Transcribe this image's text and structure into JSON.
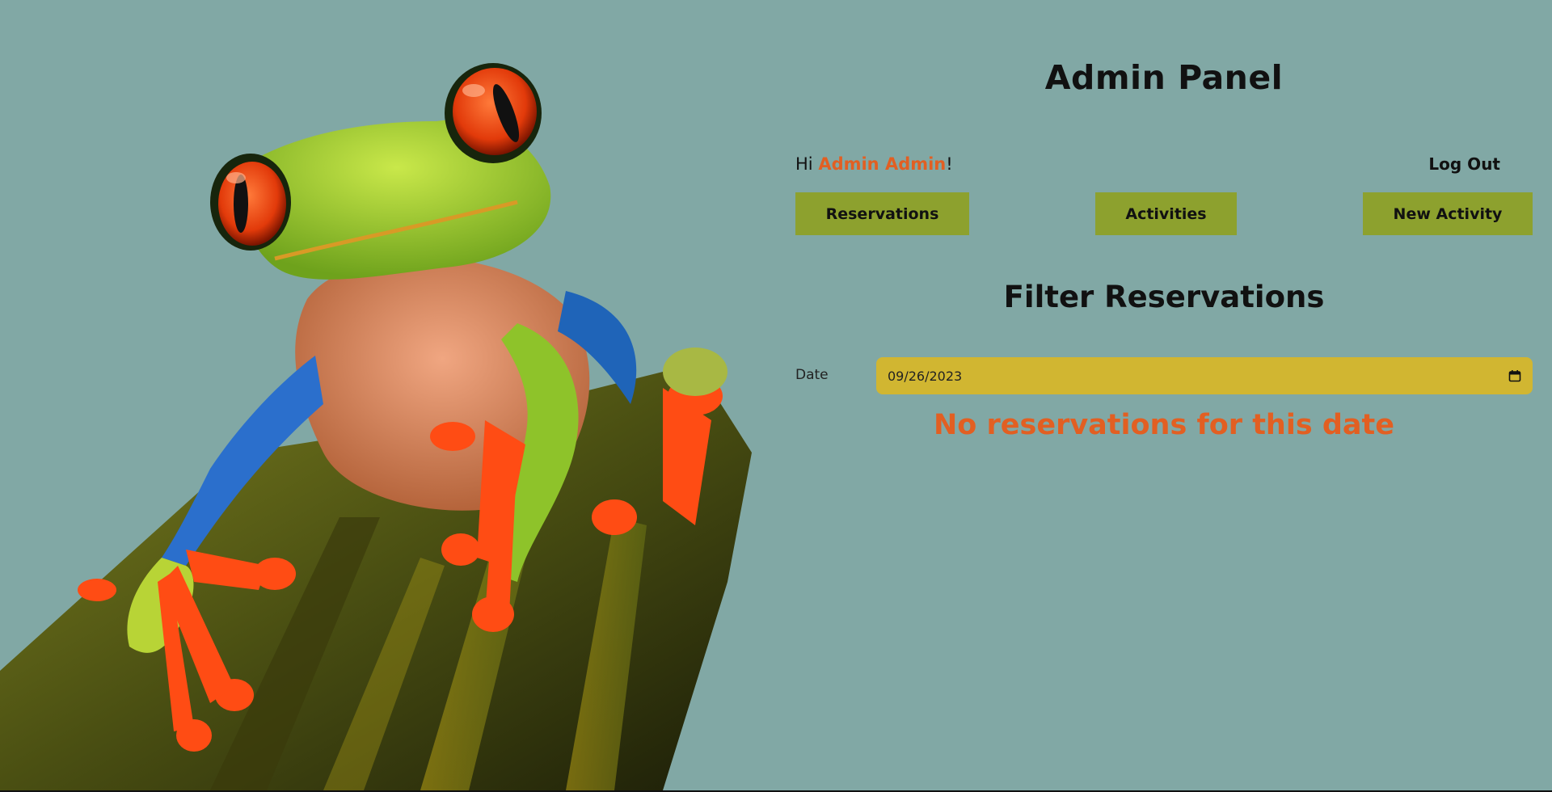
{
  "header": {
    "title": "Admin Panel"
  },
  "user_bar": {
    "greeting_prefix": "Hi ",
    "user_name": "Admin Admin",
    "greeting_suffix": "!",
    "logout_label": "Log Out"
  },
  "nav": {
    "reservations_label": "Reservations",
    "activities_label": "Activities",
    "new_activity_label": "New Activity"
  },
  "filter": {
    "title": "Filter Reservations",
    "date_label": "Date",
    "date_value": "09/26/2023",
    "empty_message": "No reservations for this date"
  },
  "hero": {
    "image_subject": "red-eyed tree frog"
  },
  "colors": {
    "background": "#81a8a5",
    "button": "#8da12e",
    "date_field": "#d1b631",
    "accent": "#e25f22",
    "text": "#111111"
  }
}
